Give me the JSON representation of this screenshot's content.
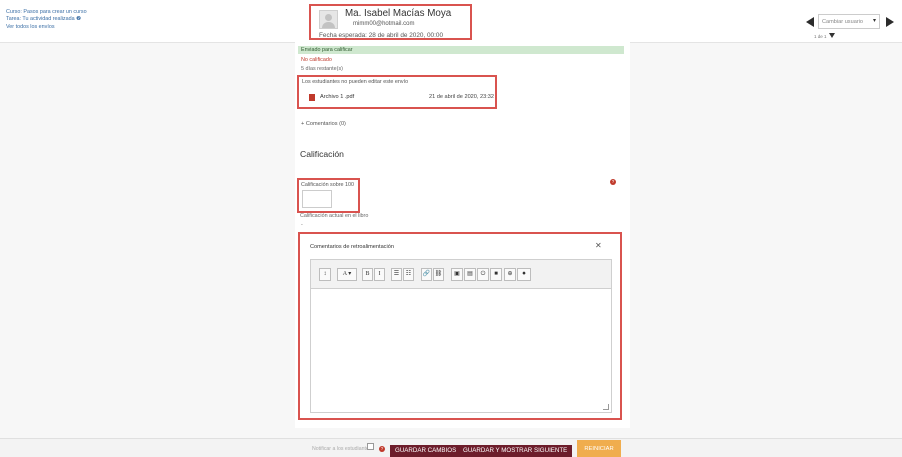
{
  "course": {
    "course_link": "Curso: Pasos para crear un curso",
    "task_link": "Tarea: Tu actividad realizada ❷",
    "all_submissions_link": "Ver todos los envíos"
  },
  "user": {
    "name": "Ma. Isabel Macías Moya",
    "email": "mimm00@hotmail.com",
    "due": "Fecha esperada: 28 de abril de 2020, 00:00"
  },
  "switcher": {
    "placeholder": "Cambiar usuario",
    "page_count": "1 de 1"
  },
  "submission": {
    "status": "Enviado para calificar",
    "grade_status": "No calificado",
    "days_left": "5 días restante(s)",
    "edit_note": "Los estudiantes no pueden editar este envío",
    "file_name": "Archivo 1 .pdf",
    "file_date": "21 de abril de 2020, 23:32",
    "comments": "+ Comentarios (0)"
  },
  "grading": {
    "section_title": "Calificación",
    "grade_label": "Calificación sobre 100",
    "current_grade": "Calificación actual en el libro",
    "current_value": "-",
    "feedback_label": "Comentarios de retroalimentación",
    "close_symbol": "✕",
    "toolbar_buttons": [
      "↕",
      "A ▾",
      "B",
      "I",
      "☰",
      "☷",
      "🔗",
      "⛓",
      "▣",
      "▤",
      "⏻",
      "■",
      "⊕",
      "⏺"
    ]
  },
  "actions": {
    "notify_label": "Notificar a los estudiantes",
    "help_symbol": "?",
    "save": "GUARDAR CAMBIOS",
    "save_next": "GUARDAR Y MOSTRAR SIGUIENTE",
    "reset": "REINICIAR"
  },
  "colors": {
    "highlight": "#d9534f",
    "primary_button": "#6d1d2b",
    "reset_button": "#f0ad4e",
    "submitted_bg": "#cfe8cf"
  }
}
